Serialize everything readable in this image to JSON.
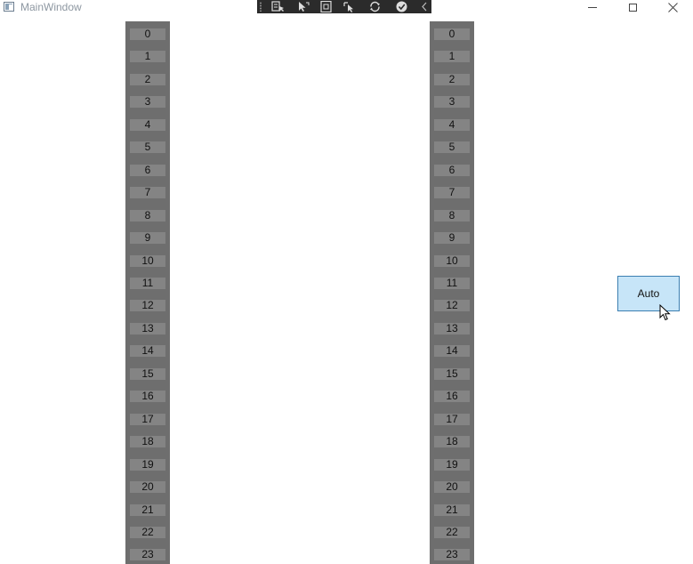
{
  "window": {
    "title": "MainWindow",
    "icon": "app-window-icon",
    "controls": [
      "minimize-icon",
      "maximize-icon",
      "close-icon"
    ]
  },
  "debug_toolbar": {
    "buttons": [
      "select-element-icon",
      "select-pointer-icon",
      "display-layout-adorners-icon",
      "track-focused-element-icon",
      "hot-reload-icon",
      "binding-failures-check-icon"
    ],
    "collapse_icon": "chevron-left-icon"
  },
  "left_list": {
    "items": [
      "0",
      "1",
      "2",
      "3",
      "4",
      "5",
      "6",
      "7",
      "8",
      "9",
      "10",
      "11",
      "12",
      "13",
      "14",
      "15",
      "16",
      "17",
      "18",
      "19",
      "20",
      "21",
      "22",
      "23"
    ]
  },
  "right_list": {
    "items": [
      "0",
      "1",
      "2",
      "3",
      "4",
      "5",
      "6",
      "7",
      "8",
      "9",
      "10",
      "11",
      "12",
      "13",
      "14",
      "15",
      "16",
      "17",
      "18",
      "19",
      "20",
      "21",
      "22",
      "23"
    ]
  },
  "auto_button": {
    "label": "Auto"
  },
  "colors": {
    "column_bg": "#6e6e6e",
    "row_bg": "#848484",
    "button_bg": "#c7e5f8",
    "button_border": "#3c7fb1",
    "toolbar_bg": "#2b2b2b"
  }
}
